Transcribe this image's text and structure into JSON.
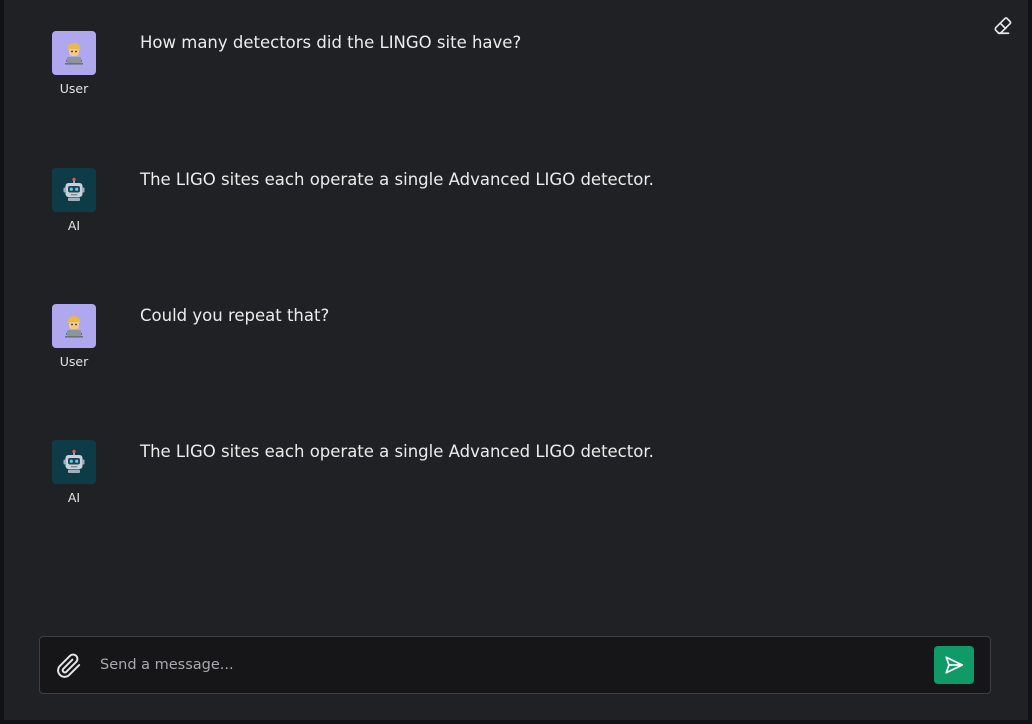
{
  "toolbar": {
    "clear_icon": "eraser-icon"
  },
  "messages": [
    {
      "role": "User",
      "avatar_icon": "person-laptop-icon",
      "text": "How many detectors did the LINGO site have?"
    },
    {
      "role": "AI",
      "avatar_icon": "robot-icon",
      "text": "The LIGO sites each operate a single Advanced LIGO detector."
    },
    {
      "role": "User",
      "avatar_icon": "person-laptop-icon",
      "text": "Could you repeat that?"
    },
    {
      "role": "AI",
      "avatar_icon": "robot-icon",
      "text": "The LIGO sites each operate a single Advanced LIGO detector."
    }
  ],
  "composer": {
    "placeholder": "Send a message...",
    "value": "",
    "attach_icon": "paperclip-icon",
    "send_icon": "send-icon"
  },
  "colors": {
    "background": "#202124",
    "user_avatar_bg": "#b0a8ee",
    "ai_avatar_bg": "#0e3c46",
    "send_button": "#0f9a67"
  }
}
